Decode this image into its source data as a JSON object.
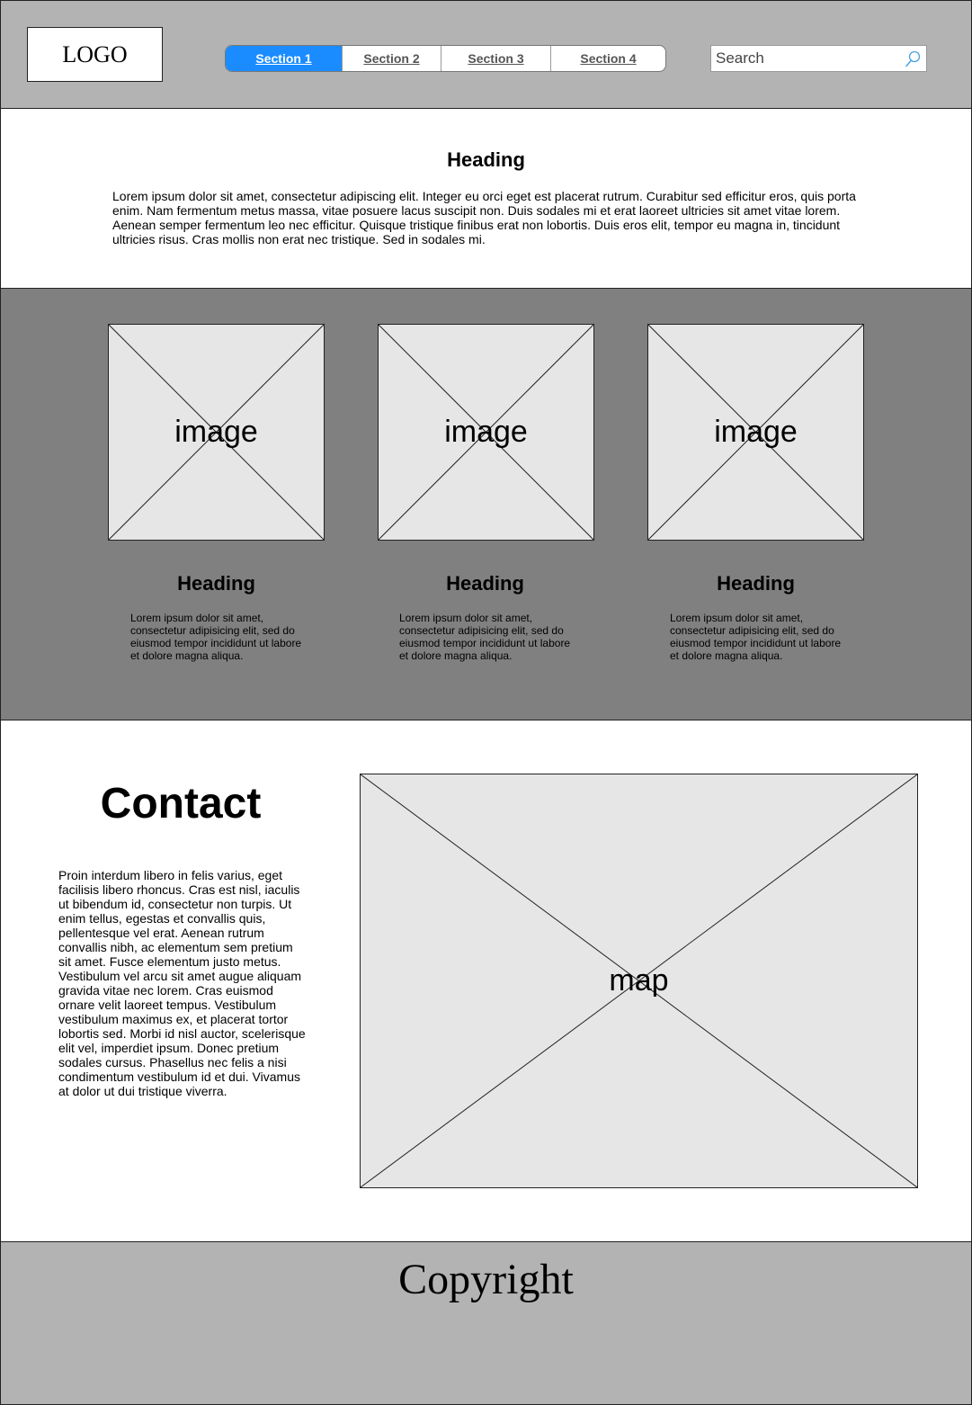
{
  "header": {
    "logo": "LOGO",
    "nav": [
      "Section 1",
      "Section 2",
      "Section 3",
      "Section 4"
    ],
    "active_tab": "Section 1",
    "search": {
      "placeholder": "Search",
      "value": ""
    }
  },
  "intro": {
    "heading": "Heading",
    "text": "Lorem ipsum dolor sit amet, consectetur adipiscing elit. Integer eu orci eget est placerat rutrum. Curabitur sed efficitur eros, quis porta enim. Nam fermentum metus massa, vitae posuere lacus suscipit non. Duis sodales mi et erat laoreet ultricies sit amet vitae lorem. Aenean semper fermentum leo nec efficitur. Quisque tristique finibus erat non lobortis. Duis eros elit, tempor eu magna in, tincidunt ultricies risus. Cras mollis non erat nec tristique. Sed in sodales mi."
  },
  "features": [
    {
      "image_label": "image",
      "heading": "Heading",
      "text": "Lorem ipsum dolor sit amet, consectetur adipisicing elit, sed do eiusmod tempor incididunt ut labore et dolore magna aliqua."
    },
    {
      "image_label": "image",
      "heading": "Heading",
      "text": "Lorem ipsum dolor sit amet, consectetur adipisicing elit, sed do eiusmod tempor incididunt ut labore et dolore magna aliqua."
    },
    {
      "image_label": "image",
      "heading": "Heading",
      "text": "Lorem ipsum dolor sit amet, consectetur adipisicing elit, sed do eiusmod tempor incididunt ut labore et dolore magna aliqua."
    }
  ],
  "contact": {
    "heading": "Contact",
    "text": "Proin interdum libero in felis varius, eget facilisis libero rhoncus. Cras est nisl, iaculis ut bibendum id, consectetur non turpis. Ut enim tellus, egestas et convallis quis, pellentesque vel erat. Aenean rutrum convallis nibh, ac elementum sem pretium sit amet. Fusce elementum justo metus. Vestibulum vel arcu sit amet augue aliquam gravida vitae nec lorem. Cras euismod ornare velit laoreet tempus. Vestibulum vestibulum maximus ex, et placerat tortor lobortis sed. Morbi id nisl auctor, scelerisque elit vel, imperdiet ipsum. Donec pretium sodales cursus. Phasellus nec felis a nisi condimentum vestibulum id et dui. Vivamus at dolor ut dui tristique viverra.",
    "map_label": "map"
  },
  "footer": {
    "copyright": "Copyright"
  },
  "colors": {
    "header_bg": "#b3b3b3",
    "band_bg": "#808080",
    "active_tab": "#1a8cff",
    "placeholder_fill": "#e6e6e6",
    "footer_bg": "#b3b3b3"
  },
  "icons": {
    "search": "search-icon"
  }
}
